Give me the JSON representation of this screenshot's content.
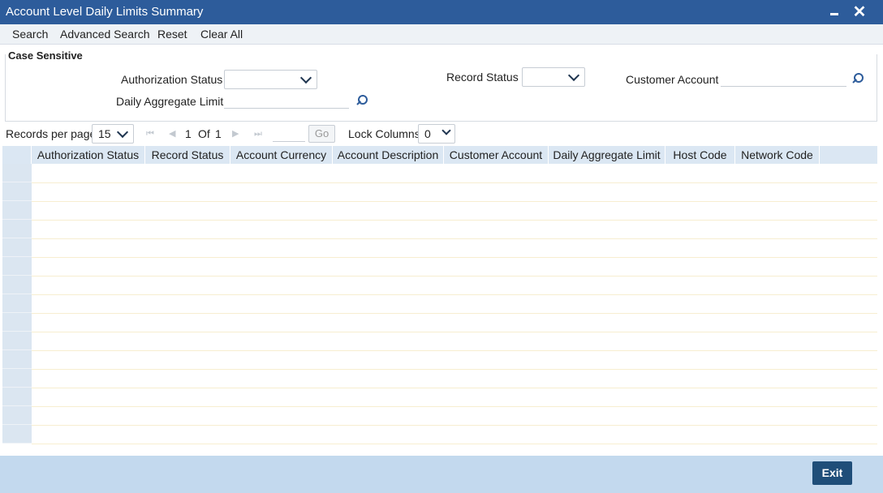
{
  "window": {
    "title": "Account Level Daily Limits Summary"
  },
  "toolbar": {
    "search": "Search",
    "advanced_search": "Advanced Search",
    "reset": "Reset",
    "clear_all": "Clear All"
  },
  "criteria": {
    "legend": "Case Sensitive",
    "authorization_status_label": "Authorization Status",
    "authorization_status_value": "",
    "record_status_label": "Record Status",
    "record_status_value": "",
    "customer_account_label": "Customer Account",
    "customer_account_value": "",
    "daily_aggregate_limit_label": "Daily Aggregate Limit",
    "daily_aggregate_limit_value": ""
  },
  "pager": {
    "records_per_page_label": "Records per page",
    "records_per_page_value": "15",
    "current_page": "1",
    "of_label": "Of",
    "total_pages": "1",
    "go_label": "Go",
    "lock_columns_label": "Lock Columns",
    "lock_columns_value": "0"
  },
  "grid": {
    "columns": [
      "Authorization Status",
      "Record Status",
      "Account Currency",
      "Account Description",
      "Customer Account",
      "Daily Aggregate Limit",
      "Host Code",
      "Network Code"
    ],
    "rows": [
      [],
      [],
      [],
      [],
      [],
      [],
      [],
      [],
      [],
      [],
      [],
      [],
      [],
      [],
      []
    ]
  },
  "footer": {
    "exit": "Exit"
  },
  "colors": {
    "titlebar": "#2d5c9b",
    "footer": "#c3d9ee",
    "exit_button": "#1f4e79",
    "grid_header": "#dbe7f3"
  }
}
